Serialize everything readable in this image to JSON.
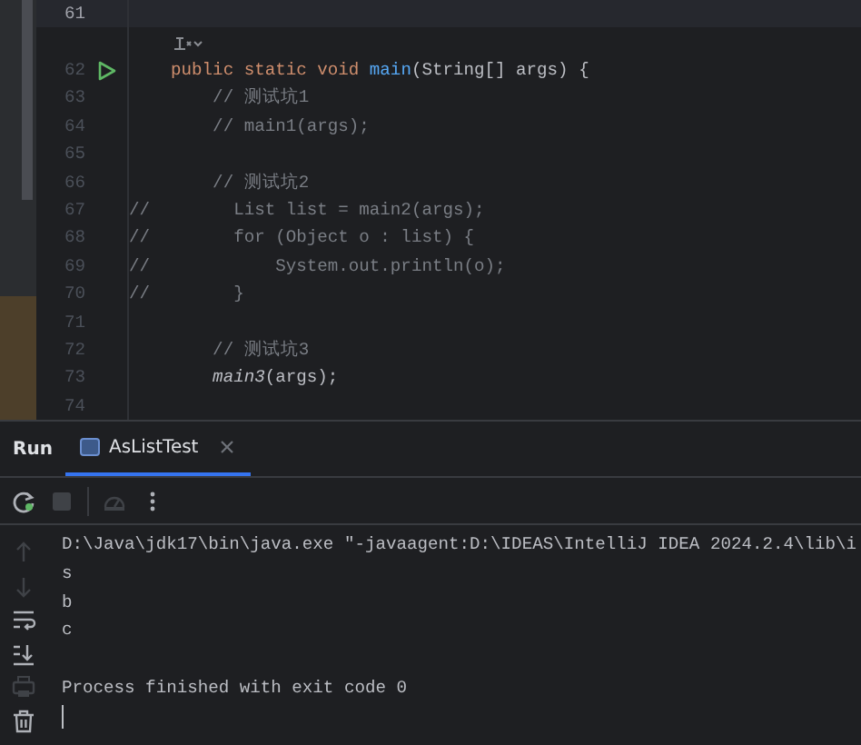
{
  "editor": {
    "lines": [
      {
        "kind": "code",
        "number": "61",
        "current": true,
        "run": false
      },
      {
        "kind": "hint",
        "current": false,
        "run": false
      },
      {
        "kind": "code",
        "number": "62",
        "current": false,
        "run": true,
        "tokens": [
          {
            "text": "    public static void ",
            "kind": "keyword"
          },
          {
            "text": "main",
            "kind": "method"
          },
          {
            "text": "(String[] args) {",
            "kind": "plain"
          }
        ]
      },
      {
        "kind": "code",
        "number": "63",
        "current": false,
        "run": false,
        "tokens": [
          {
            "text": "        // 测试坑1",
            "kind": "comment"
          }
        ]
      },
      {
        "kind": "code",
        "number": "64",
        "current": false,
        "run": false,
        "tokens": [
          {
            "text": "        // main1(args);",
            "kind": "comment"
          }
        ]
      },
      {
        "kind": "code",
        "number": "65",
        "current": false,
        "run": false
      },
      {
        "kind": "code",
        "number": "66",
        "current": false,
        "run": false,
        "tokens": [
          {
            "text": "        // 测试坑2",
            "kind": "comment"
          }
        ]
      },
      {
        "kind": "code",
        "number": "67",
        "current": false,
        "run": false,
        "tokens": [
          {
            "text": "//        List list = main2(args);",
            "kind": "comment"
          }
        ]
      },
      {
        "kind": "code",
        "number": "68",
        "current": false,
        "run": false,
        "tokens": [
          {
            "text": "//        for (Object o : list) {",
            "kind": "comment"
          }
        ]
      },
      {
        "kind": "code",
        "number": "69",
        "current": false,
        "run": false,
        "tokens": [
          {
            "text": "//            System.out.println(o);",
            "kind": "comment"
          }
        ]
      },
      {
        "kind": "code",
        "number": "70",
        "current": false,
        "run": false,
        "tokens": [
          {
            "text": "//        }",
            "kind": "comment"
          }
        ]
      },
      {
        "kind": "code",
        "number": "71",
        "current": false,
        "run": false
      },
      {
        "kind": "code",
        "number": "72",
        "current": false,
        "run": false,
        "tokens": [
          {
            "text": "        // 测试坑3",
            "kind": "comment"
          }
        ]
      },
      {
        "kind": "code",
        "number": "73",
        "current": false,
        "run": false,
        "tokens": [
          {
            "text": "        main3",
            "kind": "static-call"
          },
          {
            "text": "(args);",
            "kind": "plain"
          }
        ]
      },
      {
        "kind": "code",
        "number": "74",
        "current": false,
        "run": false
      }
    ]
  },
  "run_panel": {
    "title": "Run",
    "tabs": [
      {
        "label": "AsListTest",
        "selected": true
      }
    ],
    "toolbar": [
      {
        "kind": "rerun",
        "disabled": false
      },
      {
        "kind": "stop",
        "disabled": true
      },
      {
        "kind": "separator"
      },
      {
        "kind": "dump",
        "disabled": true
      },
      {
        "kind": "more",
        "disabled": false
      }
    ],
    "side_tools": [
      {
        "kind": "up",
        "disabled": true
      },
      {
        "kind": "down",
        "disabled": true
      },
      {
        "kind": "wrap",
        "disabled": false
      },
      {
        "kind": "scroll-end",
        "disabled": false
      },
      {
        "kind": "print",
        "disabled": true
      },
      {
        "kind": "trash",
        "disabled": false
      }
    ],
    "output": [
      {
        "kind": "stdout",
        "text": "D:\\Java\\jdk17\\bin\\java.exe \"-javaagent:D:\\IDEAS\\IntelliJ IDEA 2024.2.4\\lib\\i"
      },
      {
        "kind": "stdout",
        "text": "s"
      },
      {
        "kind": "stdout",
        "text": "b"
      },
      {
        "kind": "stdout",
        "text": "c"
      },
      {
        "kind": "exit",
        "text": "Process finished with exit code 0"
      }
    ]
  }
}
